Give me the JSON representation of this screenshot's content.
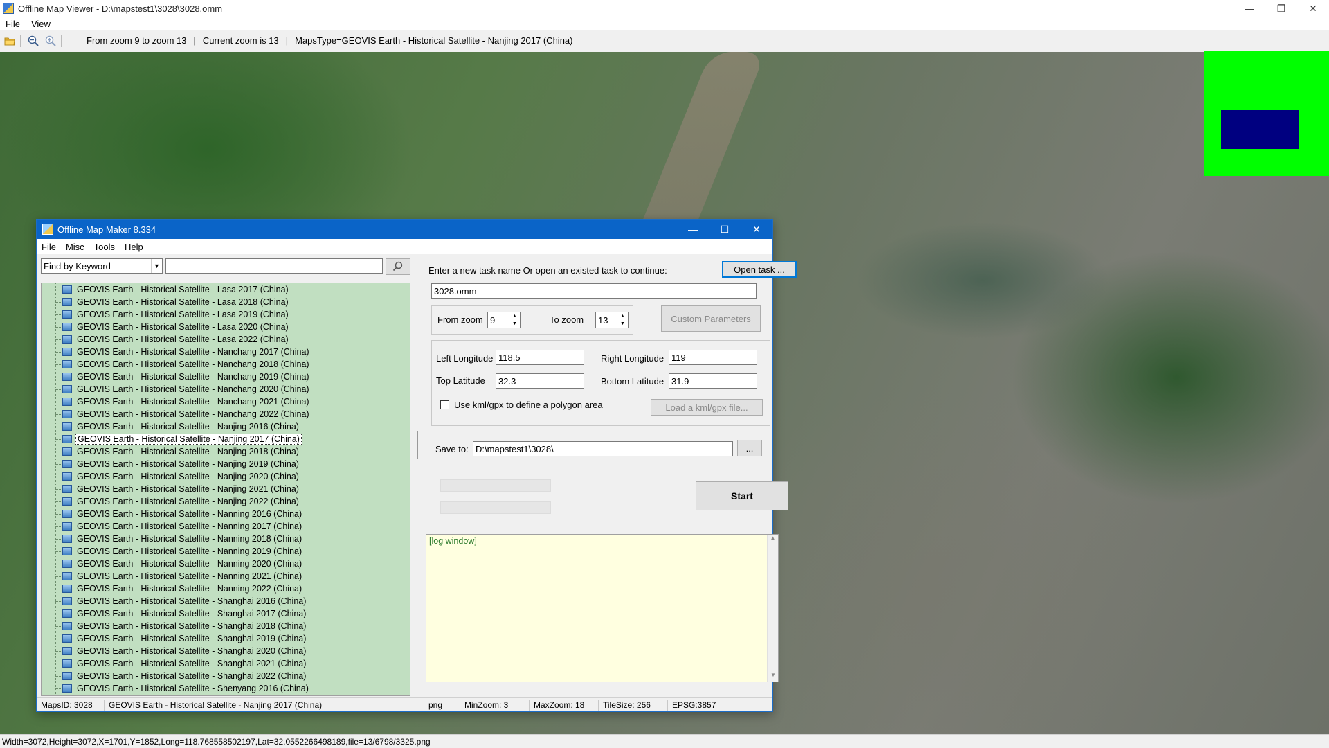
{
  "viewer": {
    "title": "Offline Map Viewer - D:\\mapstest1\\3028\\3028.omm",
    "menu": [
      "File",
      "View"
    ],
    "toolbar": {
      "zoom_range": "From zoom 9 to zoom 13",
      "current_zoom": "Current zoom is 13",
      "maps_type": "MapsType=GEOVIS Earth - Historical Satellite - Nanjing 2017 (China)",
      "pipe": "|"
    },
    "status": "Width=3072,Height=3072,X=1701,Y=1852,Long=118.768558502197,Lat=32.0552266498189,file=13/6798/3325.png"
  },
  "maker": {
    "title": "Offline Map Maker 8.334",
    "menu": [
      "File",
      "Misc",
      "Tools",
      "Help"
    ],
    "search": {
      "mode": "Find by Keyword",
      "keyword": ""
    },
    "tree_items": [
      "GEOVIS Earth - Historical Satellite - Lasa 2017 (China)",
      "GEOVIS Earth - Historical Satellite - Lasa 2018 (China)",
      "GEOVIS Earth - Historical Satellite - Lasa 2019 (China)",
      "GEOVIS Earth - Historical Satellite - Lasa 2020 (China)",
      "GEOVIS Earth - Historical Satellite - Lasa 2022 (China)",
      "GEOVIS Earth - Historical Satellite - Nanchang 2017 (China)",
      "GEOVIS Earth - Historical Satellite - Nanchang 2018 (China)",
      "GEOVIS Earth - Historical Satellite - Nanchang 2019 (China)",
      "GEOVIS Earth - Historical Satellite - Nanchang 2020 (China)",
      "GEOVIS Earth - Historical Satellite - Nanchang 2021 (China)",
      "GEOVIS Earth - Historical Satellite - Nanchang 2022 (China)",
      "GEOVIS Earth - Historical Satellite - Nanjing 2016 (China)",
      "GEOVIS Earth - Historical Satellite - Nanjing 2017 (China)",
      "GEOVIS Earth - Historical Satellite - Nanjing 2018 (China)",
      "GEOVIS Earth - Historical Satellite - Nanjing 2019 (China)",
      "GEOVIS Earth - Historical Satellite - Nanjing 2020 (China)",
      "GEOVIS Earth - Historical Satellite - Nanjing 2021 (China)",
      "GEOVIS Earth - Historical Satellite - Nanjing 2022 (China)",
      "GEOVIS Earth - Historical Satellite - Nanning 2016 (China)",
      "GEOVIS Earth - Historical Satellite - Nanning 2017 (China)",
      "GEOVIS Earth - Historical Satellite - Nanning 2018 (China)",
      "GEOVIS Earth - Historical Satellite - Nanning 2019 (China)",
      "GEOVIS Earth - Historical Satellite - Nanning 2020 (China)",
      "GEOVIS Earth - Historical Satellite - Nanning 2021 (China)",
      "GEOVIS Earth - Historical Satellite - Nanning 2022 (China)",
      "GEOVIS Earth - Historical Satellite - Shanghai 2016 (China)",
      "GEOVIS Earth - Historical Satellite - Shanghai 2017 (China)",
      "GEOVIS Earth - Historical Satellite - Shanghai 2018 (China)",
      "GEOVIS Earth - Historical Satellite - Shanghai 2019 (China)",
      "GEOVIS Earth - Historical Satellite - Shanghai 2020 (China)",
      "GEOVIS Earth - Historical Satellite - Shanghai 2021 (China)",
      "GEOVIS Earth - Historical Satellite - Shanghai 2022 (China)",
      "GEOVIS Earth - Historical Satellite - Shenyang 2016 (China)"
    ],
    "selected_item": "GEOVIS Earth - Historical Satellite - Nanjing 2017 (China)",
    "task": {
      "label": "Enter a new task name Or open an existed task to continue:",
      "open_button": "Open task ...",
      "name": "3028.omm"
    },
    "zoom": {
      "from_label": "From zoom",
      "from_value": "9",
      "to_label": "To zoom",
      "to_value": "13",
      "custom_button": "Custom Parameters"
    },
    "coords": {
      "left_lon_label": "Left Longitude",
      "left_lon": "118.5",
      "right_lon_label": "Right Longitude",
      "right_lon": "119",
      "top_lat_label": "Top Latitude",
      "top_lat": "32.3",
      "bottom_lat_label": "Bottom Latitude",
      "bottom_lat": "31.9",
      "kml_checkbox_label": "Use kml/gpx to define a polygon area",
      "kml_checked": false,
      "kml_button": "Load a kml/gpx file..."
    },
    "save": {
      "label": "Save to:",
      "path": "D:\\mapstest1\\3028\\",
      "browse": "..."
    },
    "progress": [
      0,
      0
    ],
    "start_button": "Start",
    "log_text": "[log window]",
    "status": {
      "maps_id": "MapsID: 3028",
      "map_name": "GEOVIS Earth - Historical Satellite - Nanjing 2017 (China)",
      "format": "png",
      "min_zoom": "MinZoom: 3",
      "max_zoom": "MaxZoom: 18",
      "tile_size": "TileSize: 256",
      "epsg": "EPSG:3857"
    }
  },
  "colors": {
    "title_bar": "#0a64c8",
    "tree_bg": "#c1dfc1",
    "log_bg": "#ffffe0",
    "overview_bg": "#00ff00",
    "overview_box": "#000080"
  }
}
